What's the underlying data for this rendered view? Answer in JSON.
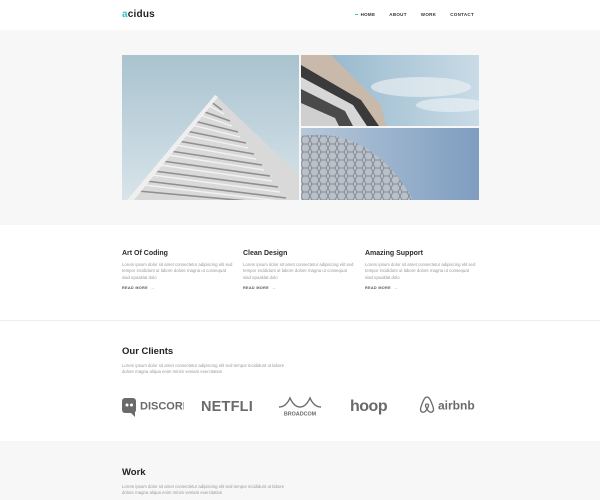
{
  "header": {
    "logo_accent": "a",
    "logo_rest": "cidus",
    "nav": [
      {
        "label": "HOME",
        "active": true
      },
      {
        "label": "ABOUT",
        "active": false
      },
      {
        "label": "WORK",
        "active": false
      },
      {
        "label": "CONTACT",
        "active": false
      }
    ]
  },
  "colors": {
    "accent": "#2fc6c6",
    "band": "#f7f7f7"
  },
  "features": [
    {
      "title": "Art Of Coding",
      "text": "Lorem ipsum dolor sit amet consectetur adipiscing elit sed tempor incididunt ut labore dolore magna ut consequat siad epuaklat dolo",
      "link": "READ MORE"
    },
    {
      "title": "Clean Design",
      "text": "Lorem ipsum dolor sit amet consectetur adipiscing elit sed tempor incididunt ut labore dolore magna ut consequat siad epuaklat dolo",
      "link": "READ MORE"
    },
    {
      "title": "Amazing Support",
      "text": "Lorem ipsum dolor sit amet consectetur adipiscing elit sed tempor incididunt ut labore dolore magna ut consequat siad epuaklat dolo",
      "link": "READ MORE"
    }
  ],
  "clients": {
    "title": "Our Clients",
    "text": "Lorem ipsum dolor sit amet consectetur adipiscing elit sed tempor incididunt ut labore dolore magna aliqua enim minim veniam exercitation",
    "logos": [
      "DISCORD",
      "NETFLIX",
      "BROADCOM",
      "hoop",
      "airbnb"
    ]
  },
  "work": {
    "title": "Work",
    "text": "Lorem ipsum dolor sit amet consectetur adipiscing elit sed tempor incididunt ut labore dolore magna aliqua enim minim veniam exercitation"
  }
}
